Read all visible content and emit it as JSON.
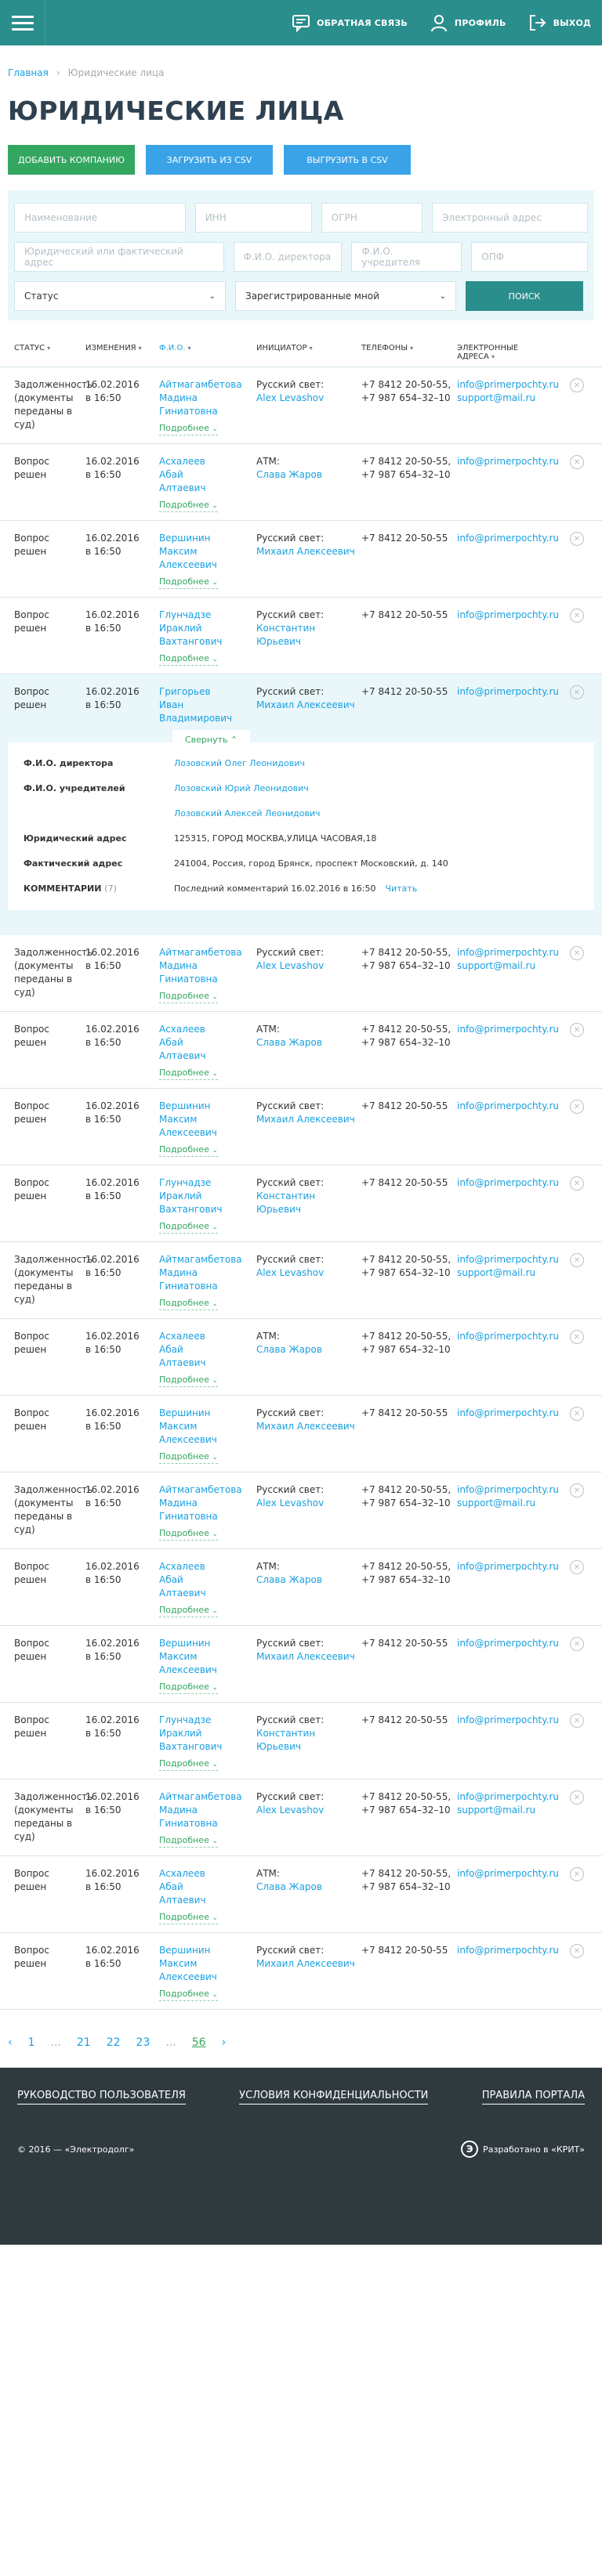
{
  "header": {
    "feedback": "ОБРАТНАЯ СВЯЗЬ",
    "profile": "ПРОФИЛЬ",
    "logout": "ВЫХОД"
  },
  "breadcrumb": {
    "home": "Главная",
    "current": "Юридические лица"
  },
  "page_title": "ЮРИДИЧЕСКИЕ ЛИЦА",
  "actions": {
    "add": "ДОБАВИТЬ КОМПАНИЮ",
    "upload": "ЗАГРУЗИТЬ ИЗ CSV",
    "export": "ВЫГРУЗИТЬ В CSV"
  },
  "filters": {
    "name": "Наименование",
    "inn": "ИНН",
    "ogrn": "ОГРН",
    "email": "Электронный адрес",
    "address": "Юридический или фактический адрес",
    "director": "Ф.И.О. директора",
    "founder": "Ф.И.О. учредителя",
    "opf": "ОПФ",
    "status": "Статус",
    "registered": "Зарегистрированные мной",
    "search": "ПОИСК"
  },
  "columns": {
    "status": "СТАТУС",
    "date": "ИЗМЕНЕНИЯ",
    "fio": "Ф.И.О.",
    "initiator": "ИНИЦИАТОР",
    "phones": "ТЕЛЕФОНЫ",
    "email_1": "ЭЛЕКТРОННЫЕ",
    "email_2": "АДРЕСА"
  },
  "more_label": "Подробнее",
  "collapse_label": "Свернуть",
  "details": {
    "director_label": "Ф.И.О. директора",
    "director": "Лозовский Олег Леонидович",
    "founder_label": "Ф.И.О. учредителей",
    "founders": [
      "Лозовский Юрий Леонидович",
      "Лозовский Алексей Леонидович"
    ],
    "legal_label": "Юридический адрес",
    "legal": "125315, ГОРОД МОСКВА,УЛИЦА ЧАСОВАЯ,18",
    "actual_label": "Фактический адрес",
    "actual": "241004, Россия, город Брянск, проспект Московский, д. 140",
    "comments_label": "КОММЕНТАРИИ",
    "comments_count": "(7)",
    "last_comment": "Последний комментарий 16.02.2016 в 16:50",
    "read": "Читать"
  },
  "rows": [
    {
      "status": [
        "Задолженность",
        "(документы",
        "переданы в суд)"
      ],
      "date": [
        "16.02.2016",
        "в 16:50"
      ],
      "fio": [
        "Айтмагамбетова",
        "Мадина",
        "Гиниатовна"
      ],
      "init_label": "Русский свет:",
      "init_name": "Alex Levashov",
      "phones": [
        "+7 8412 20-50-55,",
        "+7 987 654–32–10"
      ],
      "emails": [
        "info@primerpochty.ru",
        "support@mail.ru"
      ]
    },
    {
      "status": [
        "Вопрос решен"
      ],
      "date": [
        "16.02.2016",
        "в 16:50"
      ],
      "fio": [
        "Асхалеев",
        "Абай",
        "Алтаевич"
      ],
      "init_label": "АТМ:",
      "init_name": "Слава Жаров",
      "phones": [
        "+7 8412 20-50-55,",
        "+7 987 654–32–10"
      ],
      "emails": [
        "info@primerpochty.ru"
      ]
    },
    {
      "status": [
        "Вопрос решен"
      ],
      "date": [
        "16.02.2016",
        "в 16:50"
      ],
      "fio": [
        "Вершинин",
        "Максим",
        "Алексеевич"
      ],
      "init_label": "Русский свет:",
      "init_name": "Михаил Алексеевич",
      "phones": [
        "+7 8412 20-50-55"
      ],
      "emails": [
        "info@primerpochty.ru"
      ]
    },
    {
      "status": [
        "Вопрос решен"
      ],
      "date": [
        "16.02.2016",
        "в 16:50"
      ],
      "fio": [
        "Глунчадзе",
        "Ираклий",
        "Вахтангович"
      ],
      "init_label": "Русский свет:",
      "init_name": "Константин Юрьевич",
      "phones": [
        "+7 8412 20-50-55"
      ],
      "emails": [
        "info@primerpochty.ru"
      ]
    }
  ],
  "expanded_row": {
    "status": [
      "Вопрос решен"
    ],
    "date": [
      "16.02.2016",
      "в 16:50"
    ],
    "fio": [
      "Григорьев",
      "Иван",
      "Владимирович"
    ],
    "init_label": "Русский свет:",
    "init_name": "Михаил Алексеевич",
    "phones": [
      "+7 8412 20-50-55"
    ],
    "emails": [
      "info@primerpochty.ru"
    ]
  },
  "rows2": [
    {
      "status": [
        "Задолженность",
        "(документы",
        "переданы в суд)"
      ],
      "date": [
        "16.02.2016",
        "в 16:50"
      ],
      "fio": [
        "Айтмагамбетова",
        "Мадина",
        "Гиниатовна"
      ],
      "init_label": "Русский свет:",
      "init_name": "Alex Levashov",
      "phones": [
        "+7 8412 20-50-55,",
        "+7 987 654–32–10"
      ],
      "emails": [
        "info@primerpochty.ru",
        "support@mail.ru"
      ]
    },
    {
      "status": [
        "Вопрос решен"
      ],
      "date": [
        "16.02.2016",
        "в 16:50"
      ],
      "fio": [
        "Асхалеев",
        "Абай",
        "Алтаевич"
      ],
      "init_label": "АТМ:",
      "init_name": "Слава Жаров",
      "phones": [
        "+7 8412 20-50-55,",
        "+7 987 654–32–10"
      ],
      "emails": [
        "info@primerpochty.ru"
      ]
    },
    {
      "status": [
        "Вопрос решен"
      ],
      "date": [
        "16.02.2016",
        "в 16:50"
      ],
      "fio": [
        "Вершинин",
        "Максим",
        "Алексеевич"
      ],
      "init_label": "Русский свет:",
      "init_name": "Михаил Алексеевич",
      "phones": [
        "+7 8412 20-50-55"
      ],
      "emails": [
        "info@primerpochty.ru"
      ]
    },
    {
      "status": [
        "Вопрос решен"
      ],
      "date": [
        "16.02.2016",
        "в 16:50"
      ],
      "fio": [
        "Глунчадзе",
        "Ираклий",
        "Вахтангович"
      ],
      "init_label": "Русский свет:",
      "init_name": "Константин Юрьевич",
      "phones": [
        "+7 8412 20-50-55"
      ],
      "emails": [
        "info@primerpochty.ru"
      ]
    },
    {
      "status": [
        "Задолженность",
        "(документы",
        "переданы в суд)"
      ],
      "date": [
        "16.02.2016",
        "в 16:50"
      ],
      "fio": [
        "Айтмагамбетова",
        "Мадина",
        "Гиниатовна"
      ],
      "init_label": "Русский свет:",
      "init_name": "Alex Levashov",
      "phones": [
        "+7 8412 20-50-55,",
        "+7 987 654–32–10"
      ],
      "emails": [
        "info@primerpochty.ru",
        "support@mail.ru"
      ]
    },
    {
      "status": [
        "Вопрос решен"
      ],
      "date": [
        "16.02.2016",
        "в 16:50"
      ],
      "fio": [
        "Асхалеев",
        "Абай",
        "Алтаевич"
      ],
      "init_label": "АТМ:",
      "init_name": "Слава Жаров",
      "phones": [
        "+7 8412 20-50-55,",
        "+7 987 654–32–10"
      ],
      "emails": [
        "info@primerpochty.ru"
      ]
    },
    {
      "status": [
        "Вопрос решен"
      ],
      "date": [
        "16.02.2016",
        "в 16:50"
      ],
      "fio": [
        "Вершинин",
        "Максим",
        "Алексеевич"
      ],
      "init_label": "Русский свет:",
      "init_name": "Михаил Алексеевич",
      "phones": [
        "+7 8412 20-50-55"
      ],
      "emails": [
        "info@primerpochty.ru"
      ]
    },
    {
      "status": [
        "Задолженность",
        "(документы",
        "переданы в суд)"
      ],
      "date": [
        "16.02.2016",
        "в 16:50"
      ],
      "fio": [
        "Айтмагамбетова",
        "Мадина",
        "Гиниатовна"
      ],
      "init_label": "Русский свет:",
      "init_name": "Alex Levashov",
      "phones": [
        "+7 8412 20-50-55,",
        "+7 987 654–32–10"
      ],
      "emails": [
        "info@primerpochty.ru",
        "support@mail.ru"
      ]
    },
    {
      "status": [
        "Вопрос решен"
      ],
      "date": [
        "16.02.2016",
        "в 16:50"
      ],
      "fio": [
        "Асхалеев",
        "Абай",
        "Алтаевич"
      ],
      "init_label": "АТМ:",
      "init_name": "Слава Жаров",
      "phones": [
        "+7 8412 20-50-55,",
        "+7 987 654–32–10"
      ],
      "emails": [
        "info@primerpochty.ru"
      ]
    },
    {
      "status": [
        "Вопрос решен"
      ],
      "date": [
        "16.02.2016",
        "в 16:50"
      ],
      "fio": [
        "Вершинин",
        "Максим",
        "Алексеевич"
      ],
      "init_label": "Русский свет:",
      "init_name": "Михаил Алексеевич",
      "phones": [
        "+7 8412 20-50-55"
      ],
      "emails": [
        "info@primerpochty.ru"
      ]
    },
    {
      "status": [
        "Вопрос решен"
      ],
      "date": [
        "16.02.2016",
        "в 16:50"
      ],
      "fio": [
        "Глунчадзе",
        "Ираклий",
        "Вахтангович"
      ],
      "init_label": "Русский свет:",
      "init_name": "Константин Юрьевич",
      "phones": [
        "+7 8412 20-50-55"
      ],
      "emails": [
        "info@primerpochty.ru"
      ]
    },
    {
      "status": [
        "Задолженность",
        "(документы",
        "переданы в суд)"
      ],
      "date": [
        "16.02.2016",
        "в 16:50"
      ],
      "fio": [
        "Айтмагамбетова",
        "Мадина",
        "Гиниатовна"
      ],
      "init_label": "Русский свет:",
      "init_name": "Alex Levashov",
      "phones": [
        "+7 8412 20-50-55,",
        "+7 987 654–32–10"
      ],
      "emails": [
        "info@primerpochty.ru",
        "support@mail.ru"
      ]
    },
    {
      "status": [
        "Вопрос решен"
      ],
      "date": [
        "16.02.2016",
        "в 16:50"
      ],
      "fio": [
        "Асхалеев",
        "Абай",
        "Алтаевич"
      ],
      "init_label": "АТМ:",
      "init_name": "Слава Жаров",
      "phones": [
        "+7 8412 20-50-55,",
        "+7 987 654–32–10"
      ],
      "emails": [
        "info@primerpochty.ru"
      ]
    },
    {
      "status": [
        "Вопрос решен"
      ],
      "date": [
        "16.02.2016",
        "в 16:50"
      ],
      "fio": [
        "Вершинин",
        "Максим",
        "Алексеевич"
      ],
      "init_label": "Русский свет:",
      "init_name": "Михаил Алексеевич",
      "phones": [
        "+7 8412 20-50-55"
      ],
      "emails": [
        "info@primerpochty.ru"
      ]
    }
  ],
  "pager": {
    "prev": "‹",
    "pages": [
      "1",
      "...",
      "21",
      "22",
      "23",
      "...",
      "56"
    ],
    "current": "56",
    "next": "›"
  },
  "footer": {
    "guide": "РУКОВОДСТВО ПОЛЬЗОВАТЕЛЯ",
    "privacy": "УСЛОВИЯ КОНФИДЕНЦИАЛЬНОСТИ",
    "rules": "ПРАВИЛА ПОРТАЛА",
    "copyright": "© 2016 — «Электродолг»",
    "dev": "Разработано в «КРИТ»",
    "dev_logo": "Э"
  }
}
